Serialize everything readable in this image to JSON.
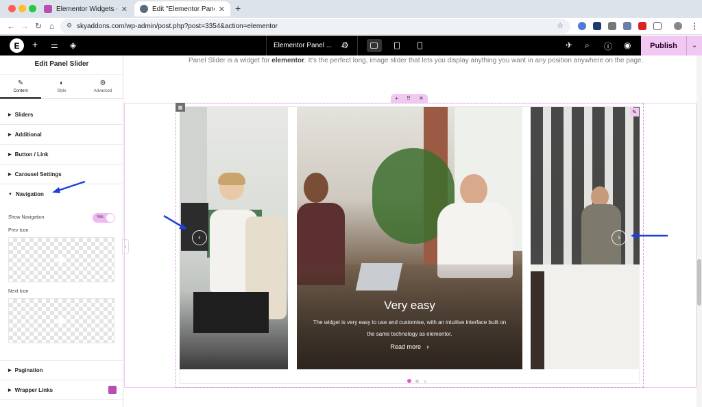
{
  "browser": {
    "tabs": [
      {
        "title": "Elementor Widgets - Sky Add",
        "favicon_color": "#b74fb3"
      },
      {
        "title": "Edit \"Elementor Panel Slider \"",
        "favicon_color": "#5a6b7b"
      }
    ],
    "new_tab_label": "+",
    "url": "skyaddons.com/wp-admin/post.php?post=3354&action=elementor"
  },
  "editor": {
    "logo_letter": "E",
    "page_selector": "Elementor Panel ...",
    "publish_label": "Publish",
    "accent_color": "#f0c8f2"
  },
  "panel": {
    "title": "Edit Panel Slider",
    "tabs": [
      {
        "label": "Content",
        "icon": "pencil-icon"
      },
      {
        "label": "Style",
        "icon": "contrast-icon"
      },
      {
        "label": "Advanced",
        "icon": "gear-icon"
      }
    ],
    "sections": {
      "sliders": "Sliders",
      "additional": "Additional",
      "button_link": "Button / Link",
      "carousel": "Carousel Settings",
      "navigation": "Navigation",
      "pagination": "Pagination",
      "wrapper_links": "Wrapper Links"
    },
    "navigation": {
      "show_navigation_label": "Show Navigation",
      "show_navigation_value": "Yes",
      "prev_icon_label": "Prev Icon",
      "next_icon_label": "Next Icon"
    }
  },
  "page": {
    "intro_before": "Panel Slider is a widget for ",
    "intro_bold": "elementor",
    "intro_after": ". It's the perfect long, image slider that lets you display anything you want in any position anywhere on the page."
  },
  "slider": {
    "active_title": "Very easy",
    "active_text": "The widget is very easy to use and customise, with an intuitive interface built on the same technology as elementor.",
    "read_more": "Read more",
    "prev_symbol": "‹",
    "next_symbol": "›",
    "pagination": {
      "count": 3,
      "active_index": 0,
      "active_color": "#e25cc6"
    }
  }
}
